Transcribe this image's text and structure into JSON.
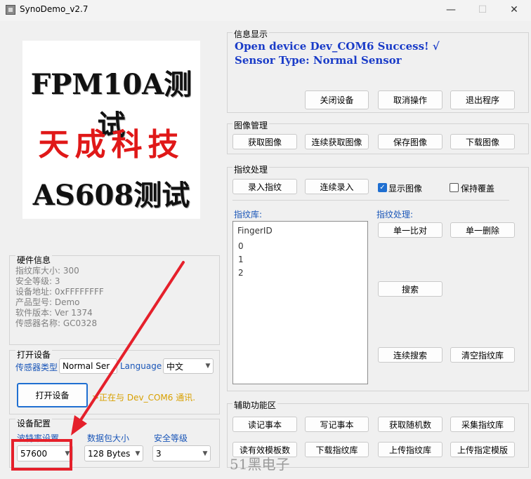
{
  "window": {
    "title": "SynoDemo_v2.7",
    "minimize": "—",
    "maximize": "☐",
    "close": "✕"
  },
  "logo": {
    "line1": "FPM10A测试",
    "line2": "天成科技",
    "line3": "AS608测试"
  },
  "hardware": {
    "title": "硬件信息",
    "lines": [
      "指纹库大小: 300",
      "安全等级: 3",
      "设备地址: 0xFFFFFFFF",
      "产品型号:  Demo",
      "软件版本: Ver 1374",
      "传感器名称: GC0328"
    ]
  },
  "open_device": {
    "title": "打开设备",
    "sensor_type_label": "传感器类型",
    "sensor_type_value": "Normal Ser",
    "language_label": "Language",
    "language_value": "中文",
    "open_button": "打开设备",
    "status": ">正在与 Dev_COM6 通讯."
  },
  "device_config": {
    "title": "设备配置",
    "baud_label": "波特率设置",
    "baud_value": "57600",
    "packet_label": "数据包大小",
    "packet_value": "128 Bytes",
    "security_label": "安全等级",
    "security_value": "3"
  },
  "info": {
    "title": "信息显示",
    "line1": "Open device Dev_COM6 Success! √",
    "line2": "Sensor Type: Normal Sensor",
    "buttons": [
      "关闭设备",
      "取消操作",
      "退出程序"
    ]
  },
  "image_mgmt": {
    "title": "图像管理",
    "buttons": [
      "获取图像",
      "连续获取图像",
      "保存图像",
      "下载图像"
    ]
  },
  "fingerprint": {
    "title": "指纹处理",
    "enroll": "录入指纹",
    "continuous_enroll": "连续录入",
    "show_image": "显示图像",
    "keep_overwrite": "保持覆盖",
    "library_label": "指纹库:",
    "process_label": "指纹处理:",
    "list_header": "FingerID",
    "list_items": [
      "0",
      "1",
      "2"
    ],
    "match_one": "单一比对",
    "delete_one": "单一删除",
    "search": "搜索",
    "continuous_search": "连续搜索",
    "clear_library": "清空指纹库"
  },
  "aux": {
    "title": "辅助功能区",
    "row1": [
      "读记事本",
      "写记事本",
      "获取随机数",
      "采集指纹库"
    ],
    "row2": [
      "读有效模板数",
      "下载指纹库",
      "上传指纹库",
      "上传指定模版"
    ]
  },
  "watermark": "51黑电子",
  "colors": {
    "highlight": "#e5202b",
    "accent": "#1f6fd1",
    "info_text": "#1a3cc8",
    "status": "#d8a000"
  }
}
